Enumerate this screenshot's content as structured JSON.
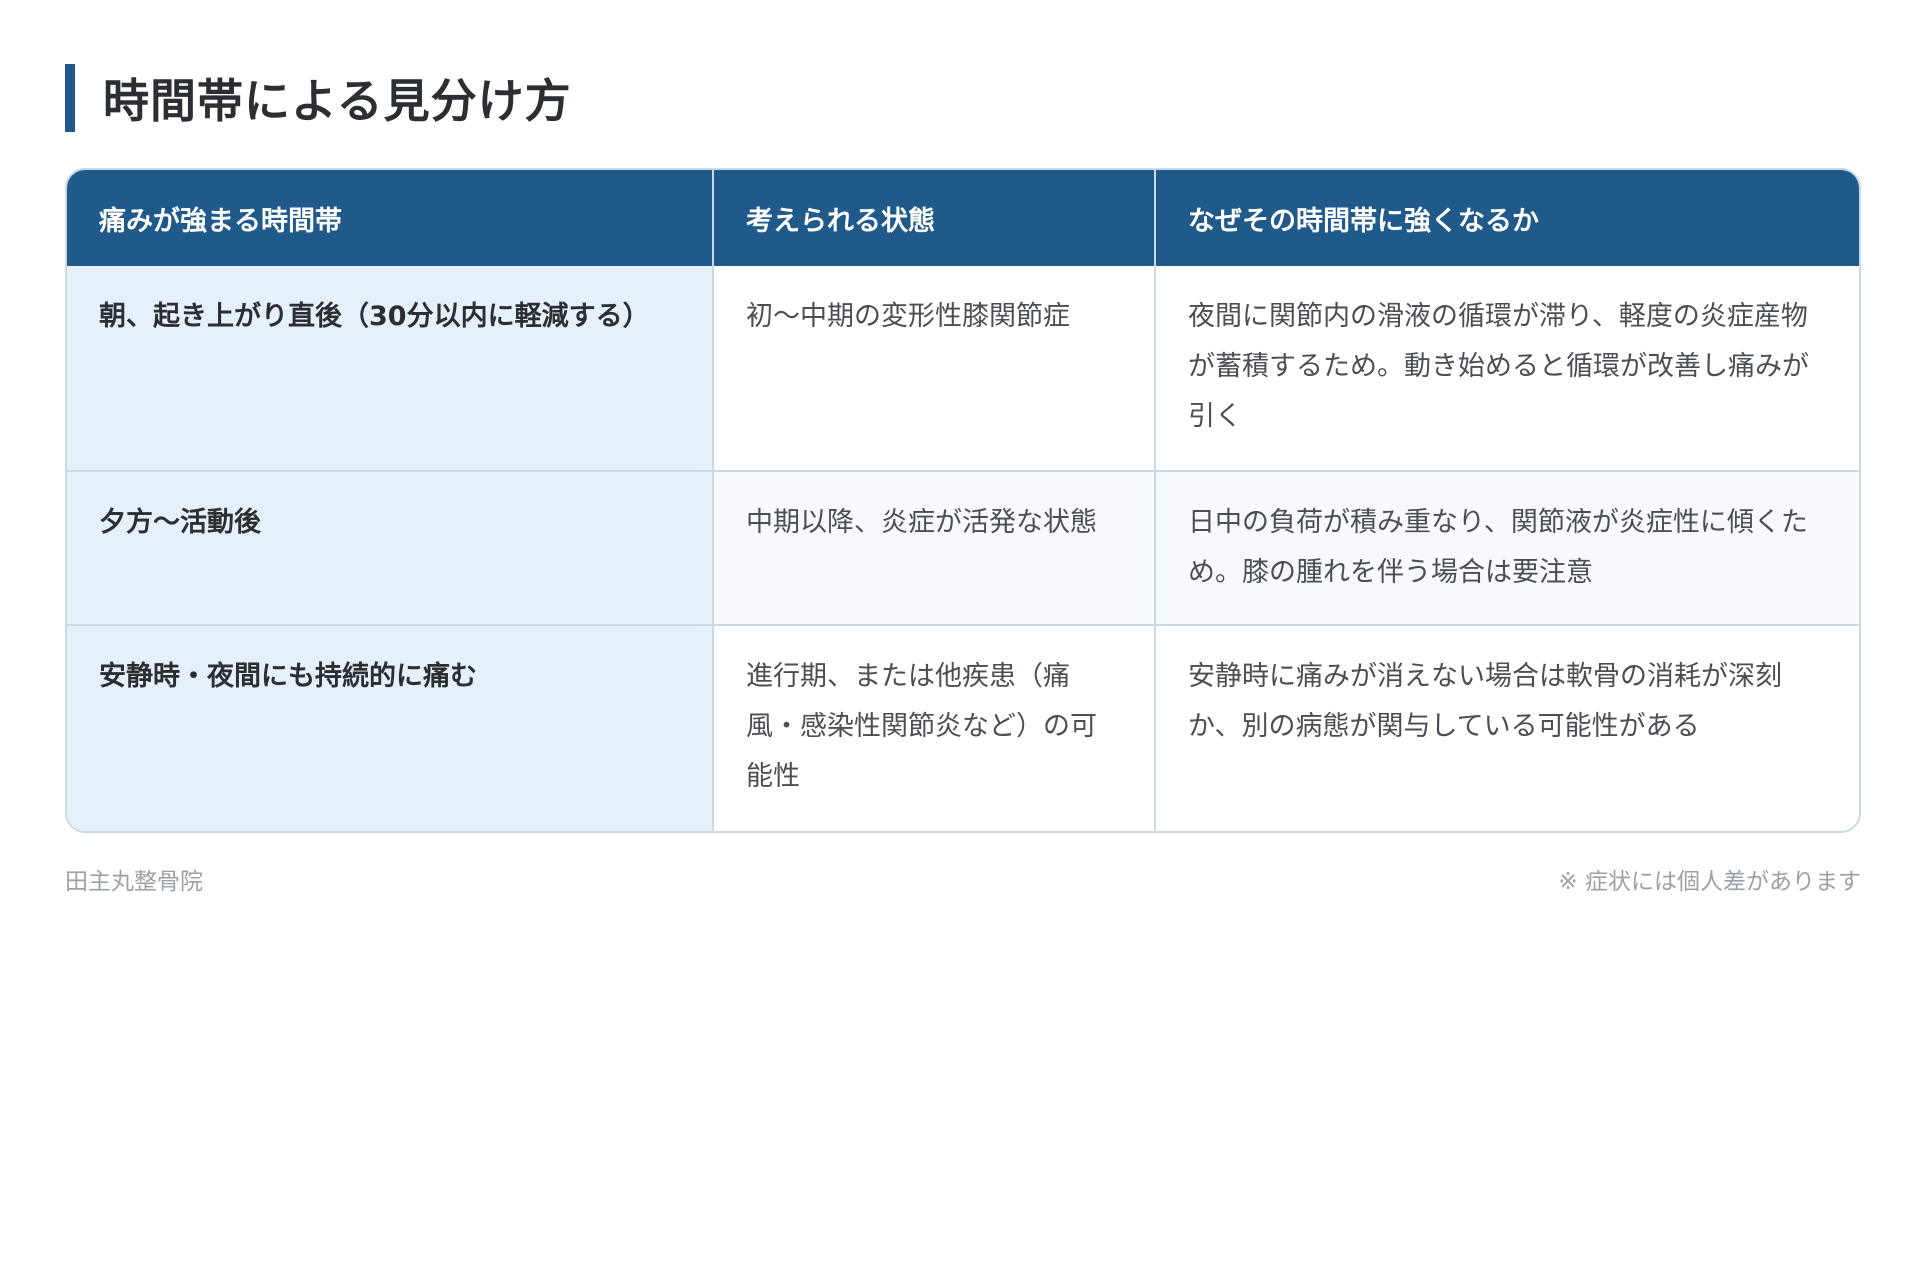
{
  "heading": {
    "title": "時間帯による見分け方"
  },
  "table": {
    "headers": [
      "痛みが強まる時間帯",
      "考えられる状態",
      "なぜその時間帯に強くなるか"
    ],
    "rows": [
      {
        "time": "朝、起き上がり直後（30分以内に軽減する）",
        "condition": "初〜中期の変形性膝関節症",
        "reason": "夜間に関節内の滑液の循環が滞り、軽度の炎症産物が蓄積するため。動き始めると循環が改善し痛みが引く"
      },
      {
        "time": "夕方〜活動後",
        "condition": "中期以降、炎症が活発な状態",
        "reason": "日中の負荷が積み重なり、関節液が炎症性に傾くため。膝の腫れを伴う場合は要注意"
      },
      {
        "time": "安静時・夜間にも持続的に痛む",
        "condition": "進行期、または他疾患（痛風・感染性関節炎など）の可能性",
        "reason": "安静時に痛みが消えない場合は軟骨の消耗が深刻か、別の病態が関与している可能性がある"
      }
    ]
  },
  "footer": {
    "clinic": "田主丸整骨院",
    "note": "※ 症状には個人差があります"
  },
  "colors": {
    "accent": "#1f5a8a",
    "header_text": "#ffffff",
    "time_cell_bg": "#e6f0f8",
    "border": "#c9d9e8"
  }
}
